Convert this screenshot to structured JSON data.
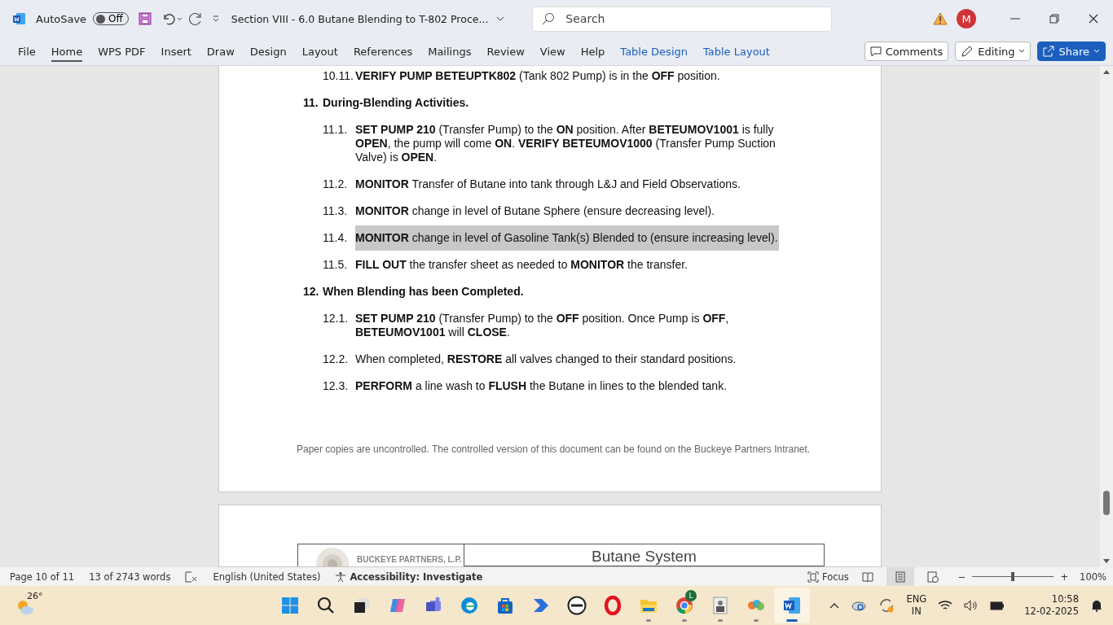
{
  "titlebar": {
    "autosave": {
      "label": "AutoSave",
      "on": false,
      "state_text": "Off"
    },
    "title": "Section VIII - 6.0 Butane Blending to T-802 Proce...",
    "search": {
      "placeholder": "Search"
    },
    "avatar": "M"
  },
  "ribbon": {
    "tabs": [
      {
        "label": "File",
        "selected": false,
        "kind": "normal"
      },
      {
        "label": "Home",
        "selected": true,
        "kind": "normal"
      },
      {
        "label": "WPS PDF",
        "selected": false,
        "kind": "normal"
      },
      {
        "label": "Insert",
        "selected": false,
        "kind": "normal"
      },
      {
        "label": "Draw",
        "selected": false,
        "kind": "normal"
      },
      {
        "label": "Design",
        "selected": false,
        "kind": "normal"
      },
      {
        "label": "Layout",
        "selected": false,
        "kind": "normal"
      },
      {
        "label": "References",
        "selected": false,
        "kind": "normal"
      },
      {
        "label": "Mailings",
        "selected": false,
        "kind": "normal"
      },
      {
        "label": "Review",
        "selected": false,
        "kind": "normal"
      },
      {
        "label": "View",
        "selected": false,
        "kind": "normal"
      },
      {
        "label": "Help",
        "selected": false,
        "kind": "normal"
      },
      {
        "label": "Table Design",
        "selected": false,
        "kind": "contextual"
      },
      {
        "label": "Table Layout",
        "selected": false,
        "kind": "contextual"
      }
    ],
    "buttons": {
      "comments": "Comments",
      "editing": "Editing",
      "share": "Share"
    }
  },
  "document": {
    "items": [
      {
        "kind": "step",
        "number": "10.11.",
        "text": "**VERIFY PUMP BETEUPTK802** (Tank 802 Pump) is in the **OFF** position.",
        "highlighted": false
      },
      {
        "kind": "heading",
        "number": "11.",
        "text": "**During-Blending Activities.**",
        "highlighted": false
      },
      {
        "kind": "step",
        "number": "11.1.",
        "text": "**SET PUMP 210** (Transfer Pump) to the **ON** position. After **BETEUMOV1001** is fully **OPEN**, the pump will come **ON**. **VERIFY BETEUMOV1000** (Transfer Pump Suction Valve) is **OPEN**.",
        "highlighted": false
      },
      {
        "kind": "step",
        "number": "11.2.",
        "text": "**MONITOR** Transfer of Butane into tank through L&J and Field Observations.",
        "highlighted": false
      },
      {
        "kind": "step",
        "number": "11.3.",
        "text": "**MONITOR** change in level of Butane Sphere (ensure decreasing level).",
        "highlighted": false
      },
      {
        "kind": "step",
        "number": "11.4.",
        "text": "**MONITOR** change in level of Gasoline Tank(s) Blended to (ensure increasing level).",
        "highlighted": true
      },
      {
        "kind": "step",
        "number": "11.5.",
        "text": "**FILL OUT** the transfer sheet as needed to **MONITOR** the transfer.",
        "highlighted": false
      },
      {
        "kind": "heading",
        "number": "12.",
        "text": "**When Blending has been Completed.**",
        "highlighted": false
      },
      {
        "kind": "step",
        "number": "12.1.",
        "text": "**SET PUMP 210** (Transfer Pump) to the **OFF** position. Once Pump is **OFF**, **BETEUMOV1001** will **CLOSE**.",
        "highlighted": false
      },
      {
        "kind": "step",
        "number": "12.2.",
        "text": "When completed, **RESTORE** all valves changed to their standard positions.",
        "highlighted": false
      },
      {
        "kind": "step",
        "number": "12.3.",
        "text": "**PERFORM** a line wash to **FLUSH** the Butane in lines to the blended tank.",
        "highlighted": false
      }
    ],
    "footer": "Paper copies are uncontrolled. The controlled version of this document can be found on the Buckeye Partners Intranet.",
    "next_page": {
      "company": "BUCKEYE PARTNERS, L.P.",
      "title": "Butane System"
    }
  },
  "status_bar": {
    "page": "Page 10 of 11",
    "words": "13 of 2743 words",
    "language": "English (United States)",
    "accessibility": "Accessibility: Investigate",
    "focus": "Focus",
    "views": [
      {
        "selected": false
      },
      {
        "selected": true
      },
      {
        "selected": false
      }
    ],
    "zoom": {
      "out": "−",
      "level": 0.5,
      "in": "+",
      "text": "100%"
    }
  },
  "taskbar": {
    "weather": "26°",
    "apps": [
      {
        "running": false
      },
      {
        "running": false
      },
      {
        "running": false
      },
      {
        "running": false
      },
      {
        "running": false
      },
      {
        "running": false
      },
      {
        "running": false
      },
      {
        "running": false
      },
      {
        "running": false
      },
      {
        "running": false
      },
      {
        "running": true
      },
      {
        "running": true,
        "badge": "L"
      },
      {
        "running": true
      },
      {
        "running": true
      },
      {
        "running": true,
        "active": true
      }
    ],
    "language": [
      "ENG",
      "IN"
    ],
    "time": "10:58",
    "date": "12-02-2025"
  }
}
